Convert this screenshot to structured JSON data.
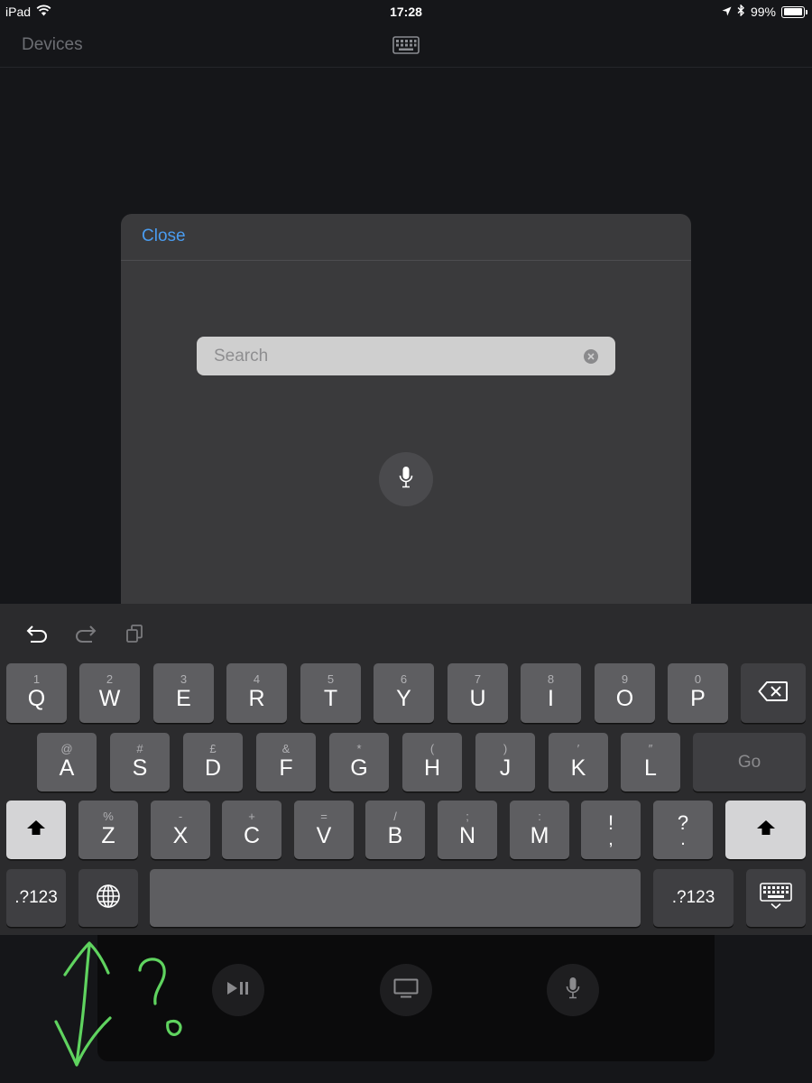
{
  "status_bar": {
    "device": "iPad",
    "time": "17:28",
    "battery": "99%"
  },
  "nav": {
    "title": "Devices"
  },
  "modal": {
    "close_label": "Close",
    "search_placeholder": "Search"
  },
  "keyboard": {
    "row1": [
      {
        "main": "Q",
        "sub": "1"
      },
      {
        "main": "W",
        "sub": "2"
      },
      {
        "main": "E",
        "sub": "3"
      },
      {
        "main": "R",
        "sub": "4"
      },
      {
        "main": "T",
        "sub": "5"
      },
      {
        "main": "Y",
        "sub": "6"
      },
      {
        "main": "U",
        "sub": "7"
      },
      {
        "main": "I",
        "sub": "8"
      },
      {
        "main": "O",
        "sub": "9"
      },
      {
        "main": "P",
        "sub": "0"
      }
    ],
    "row2": [
      {
        "main": "A",
        "sub": "@"
      },
      {
        "main": "S",
        "sub": "#"
      },
      {
        "main": "D",
        "sub": "£"
      },
      {
        "main": "F",
        "sub": "&"
      },
      {
        "main": "G",
        "sub": "*"
      },
      {
        "main": "H",
        "sub": "("
      },
      {
        "main": "J",
        "sub": ")"
      },
      {
        "main": "K",
        "sub": "′"
      },
      {
        "main": "L",
        "sub": "″"
      }
    ],
    "row3": [
      {
        "main": "Z",
        "sub": "%"
      },
      {
        "main": "X",
        "sub": "-"
      },
      {
        "main": "C",
        "sub": "+"
      },
      {
        "main": "V",
        "sub": "="
      },
      {
        "main": "B",
        "sub": "/"
      },
      {
        "main": "N",
        "sub": ";"
      },
      {
        "main": "M",
        "sub": ":"
      }
    ],
    "punct": [
      {
        "top": "!",
        "bottom": ","
      },
      {
        "top": "?",
        "bottom": "."
      }
    ],
    "go_label": "Go",
    "numbers_label": ".?123"
  },
  "icons": {
    "undo": "undo-icon",
    "redo": "redo-icon",
    "paste": "clipboard-icon",
    "delete": "backspace-icon",
    "shift": "shift-arrow-icon",
    "globe": "globe-icon",
    "hide_keyboard": "keyboard-dismiss-icon",
    "play_pause": "play-pause-icon",
    "tv": "tv-icon",
    "mic": "microphone-icon"
  },
  "colors": {
    "accent": "#4a9cf0",
    "annotation": "#5fd35f"
  }
}
